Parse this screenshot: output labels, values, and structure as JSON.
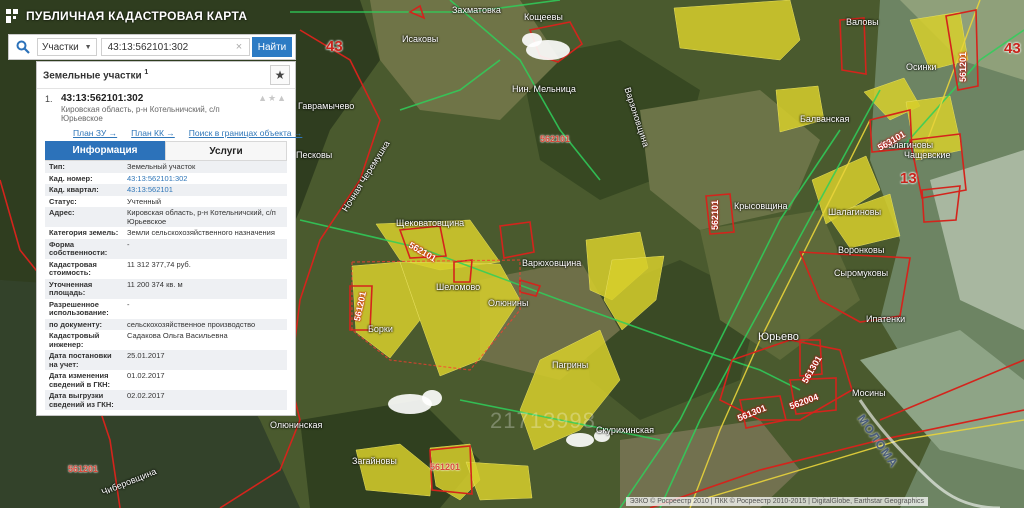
{
  "app": {
    "title": "ПУБЛИЧНАЯ КАДАСТРОВАЯ КАРТА",
    "logo_icon": "pkk-logo-icon"
  },
  "search": {
    "icon": "search-icon",
    "type_label": "Участки",
    "value": "43:13:562101:302",
    "clear_label": "×",
    "button_label": "Найти"
  },
  "results": {
    "title": "Земельные участки",
    "count": "1",
    "favorite_icon": "★",
    "item": {
      "number": "1.",
      "cad_number": "43:13:562101:302",
      "address": "Кировская область, р-н Котельничский, с/п Юрьевское",
      "actions": "▲★▲",
      "links": [
        "План ЗУ →",
        "План КК →",
        "Поиск в границах объекта →"
      ]
    },
    "tabs": [
      "Информация",
      "Услуги"
    ],
    "attributes": [
      {
        "k": "Тип:",
        "v": "Земельный участок"
      },
      {
        "k": "Кад. номер:",
        "v": "43:13:562101:302",
        "link": true
      },
      {
        "k": "Кад. квартал:",
        "v": "43:13:562101",
        "link": true
      },
      {
        "k": "Статус:",
        "v": "Учтенный"
      },
      {
        "k": "Адрес:",
        "v": "Кировская область, р-н Котельничский, с/п Юрьевское"
      },
      {
        "k": "Категория земель:",
        "v": "Земли сельскохозяйственного назначения"
      },
      {
        "k": "Форма собственности:",
        "v": "-"
      },
      {
        "k": "Кадастровая стоимость:",
        "v": "11 312 377,74 руб."
      },
      {
        "k": "Уточненная площадь:",
        "v": "11 200 374 кв. м"
      },
      {
        "k": "Разрешенное использование:",
        "v": "-"
      },
      {
        "k": "по документу:",
        "v": "сельскохозяйственное производство"
      },
      {
        "k": "Кадастровый инженер:",
        "v": "Садакова Ольга Васильевна"
      },
      {
        "k": "Дата постановки на учет:",
        "v": "25.01.2017"
      },
      {
        "k": "Дата изменения сведений в ГКН:",
        "v": "01.02.2017"
      },
      {
        "k": "Дата выгрузки сведений из ГКН:",
        "v": "02.02.2017"
      }
    ]
  },
  "map": {
    "places": [
      "Захматовка",
      "Кощеевы",
      "Исаковы",
      "Валовы",
      "Осинки",
      "Нин. Мельница",
      "Варзоновщина",
      "Гаврамычево",
      "Балванская",
      "Шалагиновы",
      "Крысовщина",
      "Шалагиновы",
      "Воронковы",
      "Щековатовщина",
      "Варюховщина",
      "Сыромуковы",
      "Шеломово",
      "Олюнины",
      "Ипатенки",
      "Борки",
      "Юрьево",
      "Пагрины",
      "Мосины",
      "Олюнинская",
      "Скурихинская",
      "Загайновы",
      "Песковы",
      "Чиберовщина",
      "Чащевские"
    ],
    "roads": [
      "Ночная Черемушка"
    ],
    "quarter_codes": [
      "562101",
      "561201",
      "561201",
      "562004",
      "561301",
      "561201",
      "562101",
      "562101",
      "563101",
      "561301",
      "561201"
    ],
    "district_codes": [
      "43",
      "43",
      "13"
    ],
    "river": "МОЛОМА",
    "watermark": "21713998"
  },
  "attribution": "ЭЗКО © Росреестр 2010 | ПКК © Росреестр 2010-2015 | DigitalGlobe, Earthstar Geographics"
}
